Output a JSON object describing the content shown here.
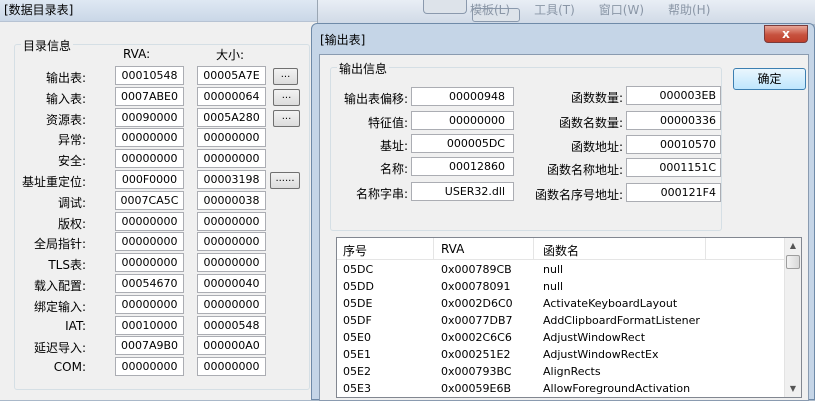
{
  "background": {
    "menu": [
      "模板(L)",
      "工具(T)",
      "窗口(W)",
      "帮助(H)"
    ]
  },
  "dir_window": {
    "title": "[数据目录表]",
    "group_title": "目录信息",
    "col_rva": "RVA:",
    "col_size": "大小:",
    "rows": [
      {
        "label": "输出表:",
        "rva": "00010548",
        "size": "00005A7E",
        "btn": "..."
      },
      {
        "label": "输入表:",
        "rva": "0007ABE0",
        "size": "00000064",
        "btn": "..."
      },
      {
        "label": "资源表:",
        "rva": "00090000",
        "size": "0005A280",
        "btn": "..."
      },
      {
        "label": "异常:",
        "rva": "00000000",
        "size": "00000000",
        "btn": ""
      },
      {
        "label": "安全:",
        "rva": "00000000",
        "size": "00000000",
        "btn": ""
      },
      {
        "label": "基址重定位:",
        "rva": "000F0000",
        "size": "00003198",
        "btn": "......"
      },
      {
        "label": "调试:",
        "rva": "0007CA5C",
        "size": "00000038",
        "btn": ""
      },
      {
        "label": "版权:",
        "rva": "00000000",
        "size": "00000000",
        "btn": ""
      },
      {
        "label": "全局指针:",
        "rva": "00000000",
        "size": "00000000",
        "btn": ""
      },
      {
        "label": "TLS表:",
        "rva": "00000000",
        "size": "00000000",
        "btn": ""
      },
      {
        "label": "载入配置:",
        "rva": "00054670",
        "size": "00000040",
        "btn": ""
      },
      {
        "label": "绑定输入:",
        "rva": "00000000",
        "size": "00000000",
        "btn": ""
      },
      {
        "label": "IAT:",
        "rva": "00010000",
        "size": "00000548",
        "btn": ""
      },
      {
        "label": "延迟导入:",
        "rva": "0007A9B0",
        "size": "000000A0",
        "btn": ""
      },
      {
        "label": "COM:",
        "rva": "00000000",
        "size": "00000000",
        "btn": ""
      }
    ]
  },
  "export_window": {
    "title": "[输出表]",
    "close_label": "x",
    "group_title": "输出信息",
    "ok_label": "确定",
    "left_fields": [
      {
        "label": "输出表偏移:",
        "value": "00000948"
      },
      {
        "label": "特征值:",
        "value": "00000000"
      },
      {
        "label": "基址:",
        "value": "000005DC"
      },
      {
        "label": "名称:",
        "value": "00012860"
      },
      {
        "label": "名称字串:",
        "value": "USER32.dll"
      }
    ],
    "right_fields": [
      {
        "label": "函数数量:",
        "value": "000003EB"
      },
      {
        "label": "函数名数量:",
        "value": "00000336"
      },
      {
        "label": "函数地址:",
        "value": "00010570"
      },
      {
        "label": "函数名称地址:",
        "value": "0001151C"
      },
      {
        "label": "函数名序号地址:",
        "value": "000121F4"
      }
    ],
    "list": {
      "headers": [
        "序号",
        "RVA",
        "函数名"
      ],
      "rows": [
        [
          "05DC",
          "0x000789CB",
          "null"
        ],
        [
          "05DD",
          "0x00078091",
          "null"
        ],
        [
          "05DE",
          "0x0002D6C0",
          "ActivateKeyboardLayout"
        ],
        [
          "05DF",
          "0x00077DB7",
          "AddClipboardFormatListener"
        ],
        [
          "05E0",
          "0x0002C6C6",
          "AdjustWindowRect"
        ],
        [
          "05E1",
          "0x000251E2",
          "AdjustWindowRectEx"
        ],
        [
          "05E2",
          "0x000793BC",
          "AlignRects"
        ],
        [
          "05E3",
          "0x00059E6B",
          "AllowForegroundActivation"
        ]
      ]
    }
  }
}
